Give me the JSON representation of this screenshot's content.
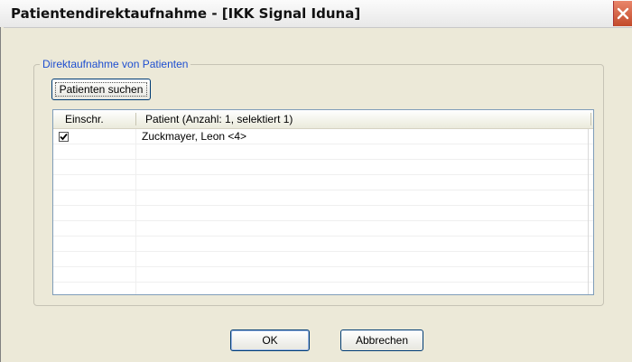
{
  "window": {
    "title": "Patientendirektaufnahme - [IKK Signal Iduna]"
  },
  "group": {
    "label": "Direktaufnahme von Patienten"
  },
  "buttons": {
    "search": "Patienten suchen",
    "ok": "OK",
    "cancel": "Abbrechen"
  },
  "list": {
    "columns": [
      "Einschr.",
      "Patient (Anzahl: 1, selektiert 1)"
    ],
    "rows": [
      {
        "checked": true,
        "patient": "Zuckmayer,  Leon <4>"
      }
    ]
  },
  "icons": {
    "close": "close-icon",
    "check": "check-icon"
  }
}
